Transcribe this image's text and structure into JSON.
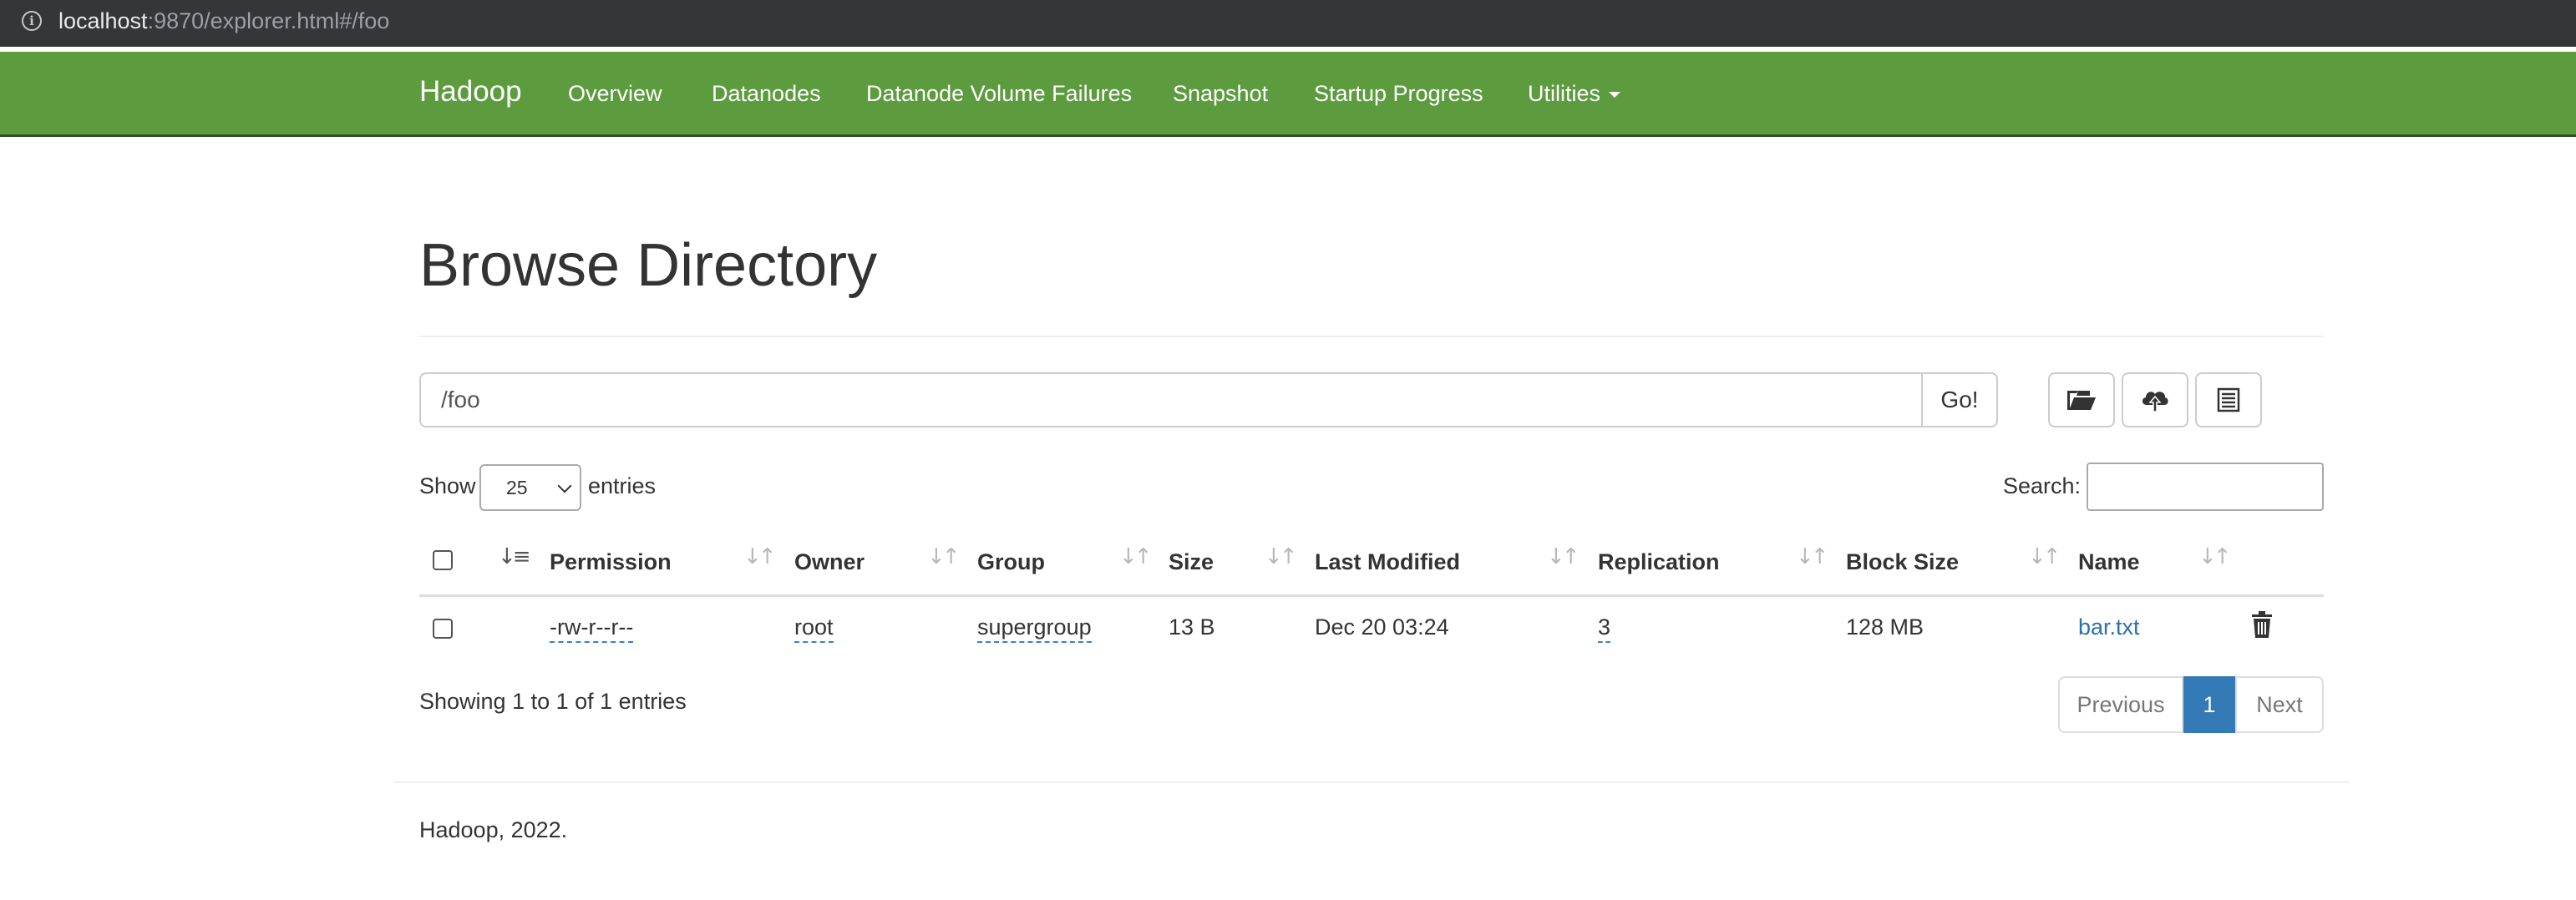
{
  "browser": {
    "url_host": "localhost",
    "url_rest": ":9870/explorer.html#/foo"
  },
  "navbar": {
    "brand": "Hadoop",
    "items": [
      {
        "label": "Overview"
      },
      {
        "label": "Datanodes"
      },
      {
        "label": "Datanode Volume Failures"
      },
      {
        "label": "Snapshot"
      },
      {
        "label": "Startup Progress"
      },
      {
        "label": "Utilities"
      }
    ],
    "color": "#5c9c3f"
  },
  "page": {
    "title": "Browse Directory"
  },
  "path_bar": {
    "value": "/foo",
    "go_label": "Go!",
    "tools": [
      "folder-open-icon",
      "cloud-upload-icon",
      "list-icon"
    ]
  },
  "controls": {
    "show_label": "Show",
    "page_size": "25",
    "entries_label": "entries",
    "search_label": "Search:",
    "search_value": ""
  },
  "table": {
    "columns": [
      "Permission",
      "Owner",
      "Group",
      "Size",
      "Last Modified",
      "Replication",
      "Block Size",
      "Name"
    ],
    "rows": [
      {
        "permission": "-rw-r--r--",
        "owner": "root",
        "group": "supergroup",
        "size": "13 B",
        "last_modified": "Dec 20 03:24",
        "replication": "3",
        "block_size": "128 MB",
        "name": "bar.txt"
      }
    ]
  },
  "footer_info": {
    "summary": "Showing 1 to 1 of 1 entries",
    "previous_label": "Previous",
    "current_page": "1",
    "next_label": "Next",
    "accent": "#337ab7"
  },
  "footer": {
    "text": "Hadoop, 2022."
  }
}
